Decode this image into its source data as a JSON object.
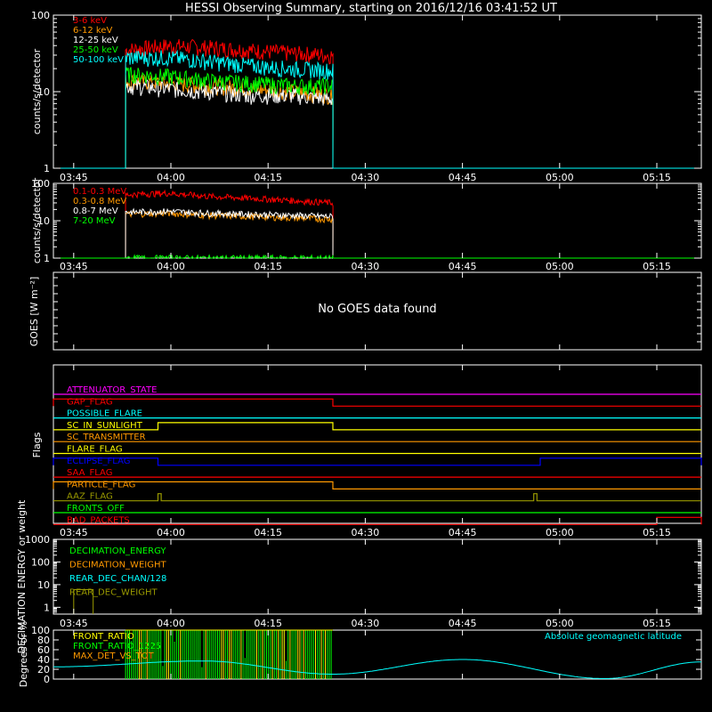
{
  "title": "HESSI Observing Summary, starting on 2016/12/16 03:41:52 UT",
  "no_goes_text": "No GOES data found",
  "time_ticks": [
    "03:45",
    "04:00",
    "04:15",
    "04:30",
    "04:45",
    "05:00",
    "05:15"
  ],
  "colors": {
    "red": "#ff0000",
    "orange": "#ff9900",
    "yellow": "#ffff00",
    "green": "#00ff00",
    "cyan": "#00ffff",
    "blue": "#0000ff",
    "magenta": "#ff00ff",
    "olive": "#999900",
    "white": "#ffffff"
  },
  "chart_data": [
    {
      "type": "line",
      "ylabel": "counts/s/detector",
      "yscale": "log",
      "ylim": [
        1,
        100
      ],
      "ytick_labels": [
        "1",
        "10",
        "100"
      ],
      "x_range": [
        "03:41:52",
        "05:21:52"
      ],
      "data_interval": [
        "03:53",
        "04:25"
      ],
      "series": [
        {
          "name": "3-6 keV",
          "color": "#ff0000",
          "values": [
            35,
            40,
            38,
            35,
            32,
            30
          ]
        },
        {
          "name": "6-12 keV",
          "color": "#ff9900",
          "values": [
            14,
            13,
            12,
            11,
            10,
            9
          ]
        },
        {
          "name": "12-25 keV",
          "color": "#ffffff",
          "values": [
            12,
            11,
            10,
            9,
            9,
            8
          ]
        },
        {
          "name": "25-50 keV",
          "color": "#00ff00",
          "values": [
            17,
            16,
            14,
            13,
            12,
            12
          ]
        },
        {
          "name": "50-100 keV",
          "color": "#00ffff",
          "values": [
            28,
            28,
            25,
            22,
            20,
            19
          ]
        }
      ]
    },
    {
      "type": "line",
      "ylabel": "counts/s/detector",
      "yscale": "log",
      "ylim": [
        1,
        100
      ],
      "ytick_labels": [
        "1",
        "10",
        "100"
      ],
      "data_interval": [
        "03:53",
        "04:25"
      ],
      "series": [
        {
          "name": "0.1-0.3 MeV",
          "color": "#ff0000",
          "values": [
            50,
            55,
            45,
            40,
            35,
            30
          ]
        },
        {
          "name": "0.3-0.8 MeV",
          "color": "#ff9900",
          "values": [
            15,
            16,
            14,
            13,
            12,
            11
          ]
        },
        {
          "name": "0.8-7 MeV",
          "color": "#ffffff",
          "values": [
            17,
            18,
            16,
            15,
            14,
            13
          ]
        },
        {
          "name": "7-20 MeV",
          "color": "#00ff00",
          "values": [
            1,
            1,
            1,
            1,
            1,
            1
          ]
        }
      ]
    },
    {
      "type": "line",
      "ylabel": "GOES [W m⁻²]",
      "series": []
    },
    {
      "type": "table",
      "ylabel": "Flags",
      "flags": [
        {
          "name": "ATTENUATOR_STATE",
          "color": "#ff00ff",
          "on_intervals": []
        },
        {
          "name": "GAP_FLAG",
          "color": "#ff0000",
          "on_intervals": [
            [
              "03:41:52",
              "04:25"
            ]
          ]
        },
        {
          "name": "POSSIBLE_FLARE",
          "color": "#00ffff",
          "on_intervals": []
        },
        {
          "name": "SC_IN_SUNLIGHT",
          "color": "#ffff00",
          "on_intervals": [
            [
              "03:58",
              "04:25"
            ]
          ]
        },
        {
          "name": "SC_TRANSMITTER",
          "color": "#ff9900",
          "on_intervals": []
        },
        {
          "name": "FLARE_FLAG",
          "color": "#ffff00",
          "on_intervals": []
        },
        {
          "name": "ECLIPSE_FLAG",
          "color": "#0000ff",
          "on_intervals": [
            [
              "03:41:52",
              "03:58"
            ],
            [
              "04:57",
              "05:21:52"
            ]
          ]
        },
        {
          "name": "SAA_FLAG",
          "color": "#ff0000",
          "on_intervals": []
        },
        {
          "name": "PARTICLE_FLAG",
          "color": "#ff9900",
          "on_intervals": [
            [
              "03:41:52",
              "04:25"
            ]
          ]
        },
        {
          "name": "AAZ_FLAG",
          "color": "#999900",
          "on_intervals": [
            [
              "03:58",
              "03:58:30"
            ],
            [
              "04:56",
              "04:56:30"
            ]
          ]
        },
        {
          "name": "FRONTS_OFF",
          "color": "#00ff00",
          "on_intervals": []
        },
        {
          "name": "BAD_PACKETS",
          "color": "#ff0000",
          "on_intervals": [
            [
              "05:15",
              "05:21:52"
            ]
          ]
        }
      ]
    },
    {
      "type": "line",
      "ylabel": "DECIMATION ENERGY or weight",
      "yscale": "log",
      "ylim": [
        0.5,
        1000
      ],
      "ytick_labels": [
        "1",
        "10",
        "100",
        "1000"
      ],
      "series": [
        {
          "name": "DECIMATION_ENERGY",
          "color": "#00ff00",
          "values": []
        },
        {
          "name": "DECIMATION_WEIGHT",
          "color": "#ff9900",
          "values": []
        },
        {
          "name": "REAR_DEC_CHAN/128",
          "color": "#00ffff",
          "values": []
        },
        {
          "name": "REAR_DEC_WEIGHT",
          "color": "#999900",
          "values": [
            {
              "from": "03:45",
              "to": "03:48",
              "value": 6
            }
          ]
        }
      ]
    },
    {
      "type": "line",
      "ylabel": "Degrees or %",
      "ylim": [
        0,
        100
      ],
      "ytick_labels": [
        "0",
        "20",
        "40",
        "60",
        "80",
        "100"
      ],
      "series": [
        {
          "name": "FRONT_RATIO",
          "color": "#ffff00",
          "values": []
        },
        {
          "name": "FRONT_RATIO_1225",
          "color": "#00ff00",
          "values": []
        },
        {
          "name": "MAX_DET_VS_TOT",
          "color": "#ff9900",
          "values": []
        },
        {
          "name": "Absolute geomagnetic latitude",
          "color": "#00ffff",
          "x": [
            "03:41:52",
            "04:05",
            "04:25",
            "04:45",
            "05:07",
            "05:21:52"
          ],
          "values": [
            25,
            37,
            10,
            40,
            1,
            35
          ]
        }
      ]
    }
  ]
}
